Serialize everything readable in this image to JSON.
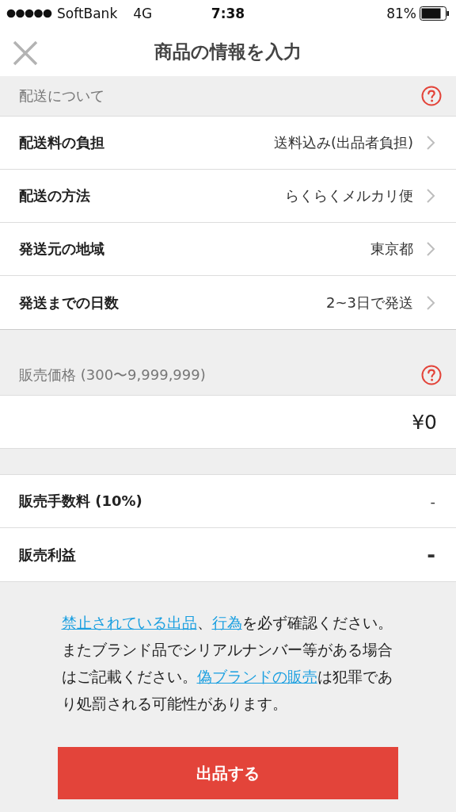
{
  "status_bar": {
    "carrier": "SoftBank",
    "network": "4G",
    "time": "7:38",
    "battery": "81%"
  },
  "nav": {
    "title": "商品の情報を入力"
  },
  "shipping": {
    "header": "配送について",
    "rows": [
      {
        "label": "配送料の負担",
        "value": "送料込み(出品者負担)"
      },
      {
        "label": "配送の方法",
        "value": "らくらくメルカリ便"
      },
      {
        "label": "発送元の地域",
        "value": "東京都"
      },
      {
        "label": "発送までの日数",
        "value": "2~3日で発送"
      }
    ]
  },
  "price": {
    "header": "販売価格 (300〜9,999,999)",
    "value": "¥0"
  },
  "summary": [
    {
      "kind": "fee",
      "label": "販売手数料 (10%)",
      "value": "-"
    },
    {
      "kind": "profit",
      "label": "販売利益",
      "value": "-"
    }
  ],
  "notice": [
    {
      "text": "禁止されている出品",
      "link": true
    },
    {
      "text": "、",
      "link": false
    },
    {
      "text": "行為",
      "link": true
    },
    {
      "text": "を必ず確認ください。またブランド品でシリアルナンバー等がある場合はご記載ください。",
      "link": false
    },
    {
      "text": "偽ブランドの販売",
      "link": true
    },
    {
      "text": "は犯罪であり処罰される可能性があります。",
      "link": false
    }
  ],
  "submit": {
    "label": "出品する"
  }
}
